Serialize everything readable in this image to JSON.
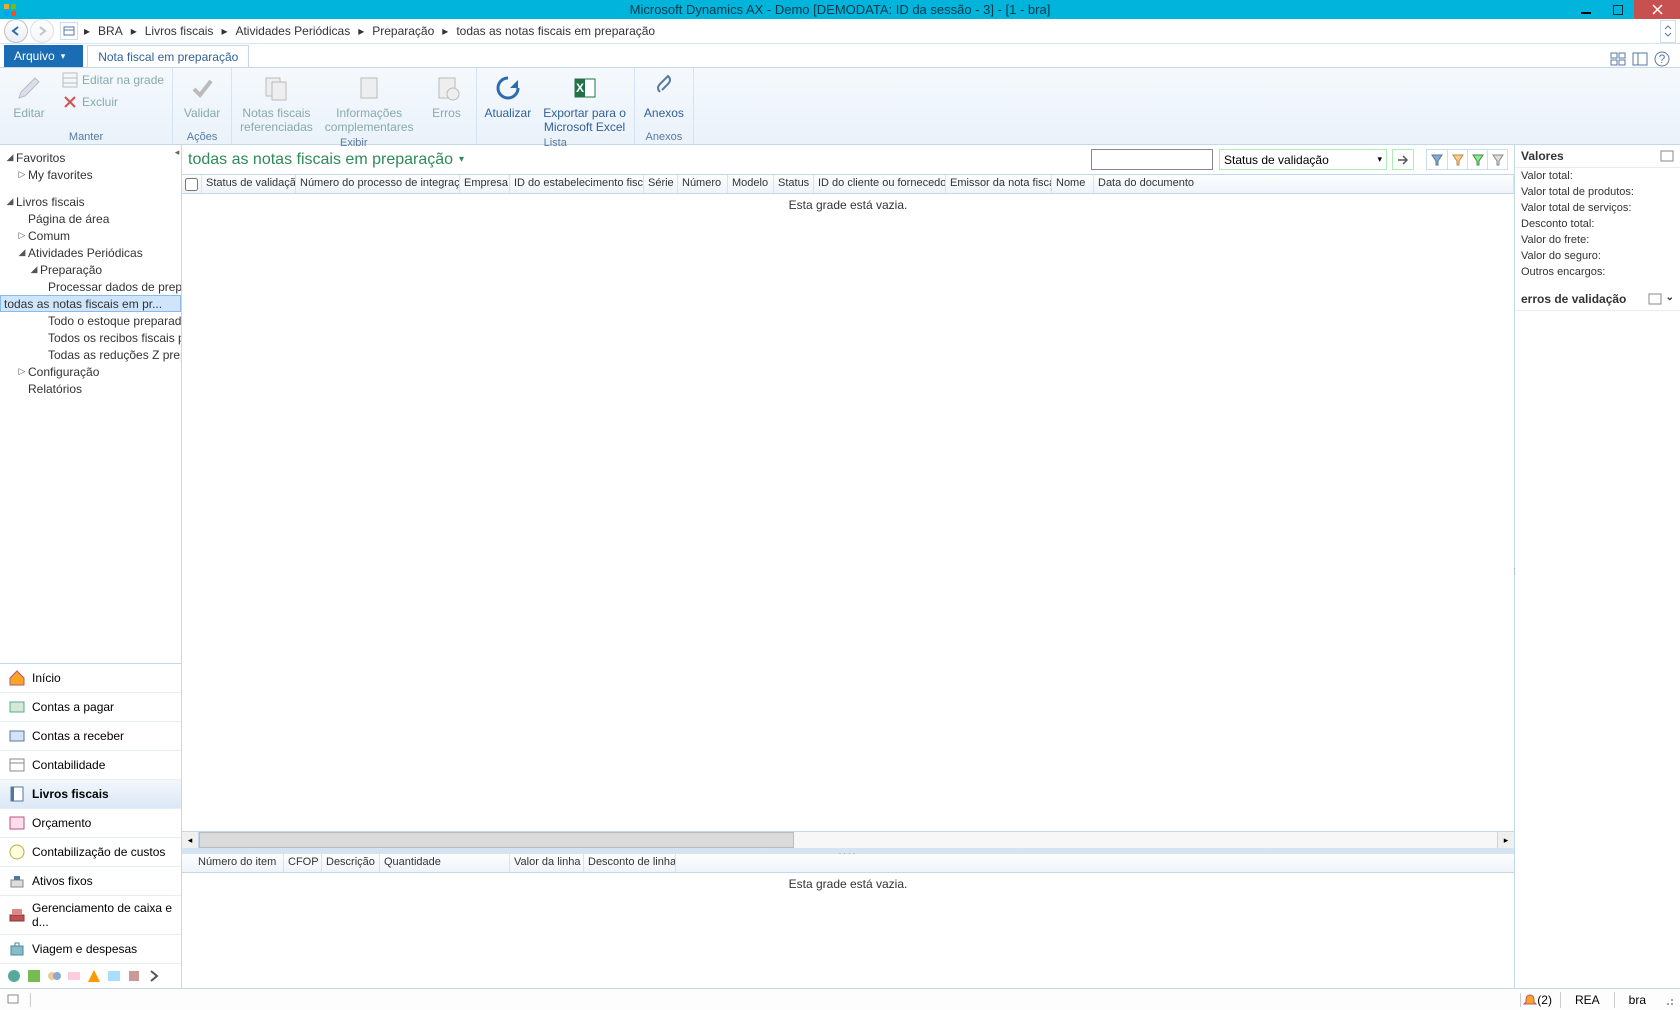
{
  "titlebar": {
    "title": "Microsoft Dynamics AX - Demo [DEMODATA: ID da sessão - 3] -  [1 - bra]"
  },
  "breadcrumb": {
    "items": [
      "BRA",
      "Livros fiscais",
      "Atividades Periódicas",
      "Preparação",
      "todas as notas fiscais em preparação"
    ]
  },
  "ribbon_tabs": {
    "file": "Arquivo",
    "active": "Nota fiscal em preparação"
  },
  "ribbon": {
    "maintain": {
      "edit": "Editar",
      "edit_in_grid": "Editar na grade",
      "delete": "Excluir",
      "group": "Manter"
    },
    "actions": {
      "validate": "Validar",
      "group": "Ações"
    },
    "view": {
      "referenced": "Notas fiscais\nreferenciadas",
      "complementary": "Informações\ncomplementares",
      "errors": "Erros",
      "group": "Exibir"
    },
    "list": {
      "refresh": "Atualizar",
      "export": "Exportar para o\nMicrosoft Excel",
      "group": "Lista"
    },
    "attachments": {
      "attachments": "Anexos",
      "group": "Anexos"
    }
  },
  "favorites": {
    "label": "Favoritos",
    "my": "My favorites"
  },
  "nav_tree": {
    "module": "Livros fiscais",
    "area_page": "Página de área",
    "common": "Comum",
    "periodic": "Atividades Periódicas",
    "preparation": "Preparação",
    "prep_children": [
      "Processar dados de preparo",
      "todas as notas fiscais em pr...",
      "Todo o estoque preparado ...",
      "Todos os recibos fiscais pre...",
      "Todas as reduções Z prepar..."
    ],
    "configuration": "Configuração",
    "reports": "Relatórios"
  },
  "nav_modules": [
    "Início",
    "Contas a pagar",
    "Contas a receber",
    "Contabilidade",
    "Livros fiscais",
    "Orçamento",
    "Contabilização de custos",
    "Ativos fixos",
    "Gerenciamento de caixa e d...",
    "Viagem e despesas"
  ],
  "list": {
    "title": "todas as notas fiscais em preparação",
    "filter_field": "Status de validação",
    "columns": [
      "Status de validação",
      "Número do processo de integração",
      "Empresa",
      "ID do estabelecimento fiscal",
      "Série",
      "Número",
      "Modelo",
      "Status",
      "ID do cliente ou fornecedor",
      "Emissor da nota fiscal",
      "Nome",
      "Data do documento"
    ],
    "empty": "Esta grade está vazia."
  },
  "lines": {
    "columns": [
      "Número do item",
      "CFOP",
      "Descrição",
      "Quantidade",
      "Valor da linha",
      "Desconto de linha"
    ],
    "empty": "Esta grade está vazia."
  },
  "details": {
    "values_head": "Valores",
    "rows": [
      "Valor total:",
      "Valor total de produtos:",
      "Valor total de serviços:",
      "Desconto total:",
      "Valor do frete:",
      "Valor do seguro:",
      "Outros encargos:"
    ],
    "errors_head": "erros de validação"
  },
  "statusbar": {
    "notify": "(2)",
    "currency": "REA",
    "company": "bra"
  }
}
